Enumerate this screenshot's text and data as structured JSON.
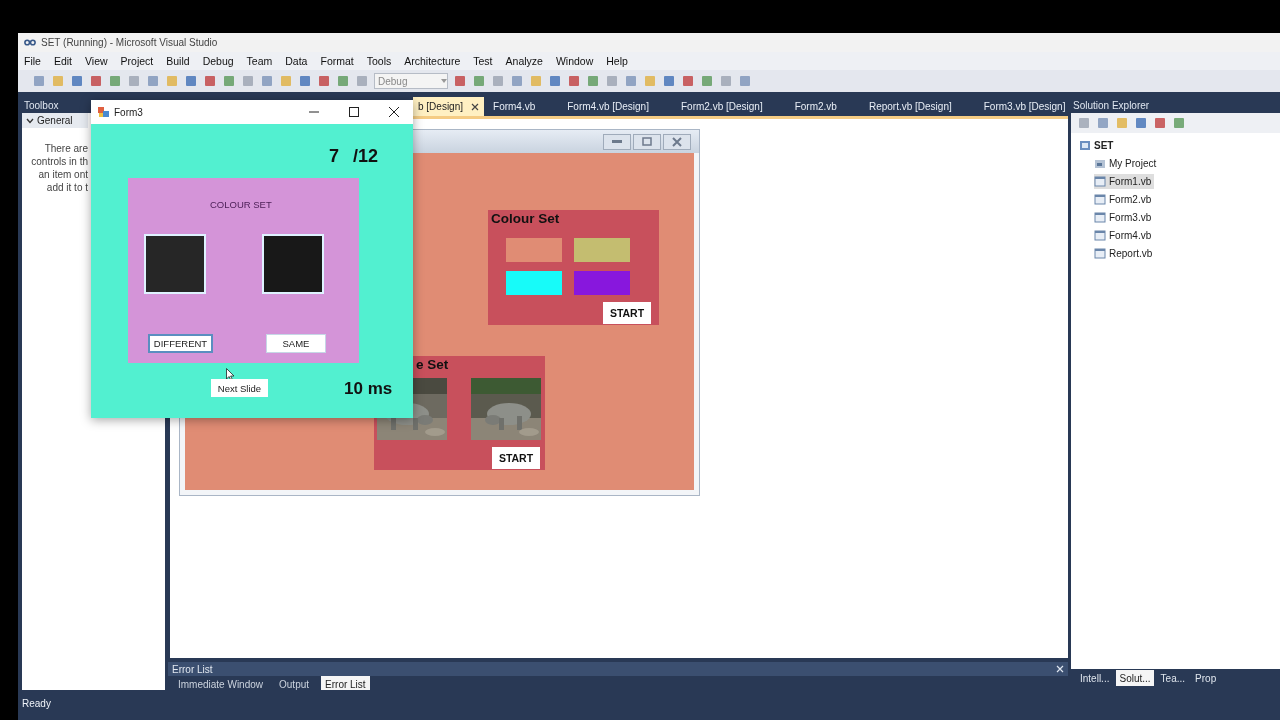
{
  "window": {
    "title": "SET (Running) - Microsoft Visual Studio"
  },
  "menu": [
    "File",
    "Edit",
    "View",
    "Project",
    "Build",
    "Debug",
    "Team",
    "Data",
    "Format",
    "Tools",
    "Architecture",
    "Test",
    "Analyze",
    "Window",
    "Help"
  ],
  "toolbar": {
    "configuration": "Debug"
  },
  "toolbox": {
    "title": "Toolbox",
    "group": "General",
    "expanded": true,
    "message_lines": [
      "There are",
      "controls in th",
      "an item ont",
      "add it to t"
    ]
  },
  "document_tabs": [
    {
      "label": "b [Design]",
      "selected": true
    },
    {
      "label": "Form4.vb",
      "selected": false
    },
    {
      "label": "Form4.vb [Design]",
      "selected": false
    },
    {
      "label": "Form2.vb [Design]",
      "selected": false
    },
    {
      "label": "Form2.vb",
      "selected": false
    },
    {
      "label": "Report.vb [Design]",
      "selected": false
    },
    {
      "label": "Form3.vb [Design]",
      "selected": false
    }
  ],
  "designer": {
    "panels": [
      {
        "kind": "colours",
        "title": "Colour Set",
        "swatches": [
          {
            "color": "#e08c74"
          },
          {
            "color": "#c4bd70"
          },
          {
            "color": "#17fbf9"
          },
          {
            "color": "#8817dd"
          }
        ],
        "button": "START"
      },
      {
        "kind": "pictures",
        "title": "e Set",
        "button": "START"
      }
    ]
  },
  "form3": {
    "title": "Form3",
    "counter": "7",
    "total": "/12",
    "panel_title": "COLOUR SET",
    "squares": [
      {
        "color": "#262626"
      },
      {
        "color": "#181818"
      }
    ],
    "answers": [
      "DIFFERENT",
      "SAME"
    ],
    "next_button": "Next Slide",
    "timer": "10 ms"
  },
  "solution_explorer": {
    "title": "Solution Explorer",
    "tree": [
      {
        "label": "SET",
        "kind": "solution",
        "selected": false,
        "children": [
          {
            "label": "My Project",
            "kind": "project",
            "selected": false
          },
          {
            "label": "Form1.vb",
            "kind": "form",
            "selected": true
          },
          {
            "label": "Form2.vb",
            "kind": "form",
            "selected": false
          },
          {
            "label": "Form3.vb",
            "kind": "form",
            "selected": false
          },
          {
            "label": "Form4.vb",
            "kind": "form",
            "selected": false
          },
          {
            "label": "Report.vb",
            "kind": "form",
            "selected": false
          }
        ]
      }
    ]
  },
  "error_list": {
    "title": "Error List",
    "tabs": [
      {
        "label": "Immediate Window",
        "selected": false
      },
      {
        "label": "Output",
        "selected": false
      },
      {
        "label": "Error List",
        "selected": true
      }
    ]
  },
  "side_tabs": [
    {
      "label": "Intell...",
      "selected": false
    },
    {
      "label": "Solut...",
      "selected": true
    },
    {
      "label": "Tea...",
      "selected": false
    },
    {
      "label": "Prop",
      "selected": false
    }
  ],
  "status_bar": "Ready"
}
